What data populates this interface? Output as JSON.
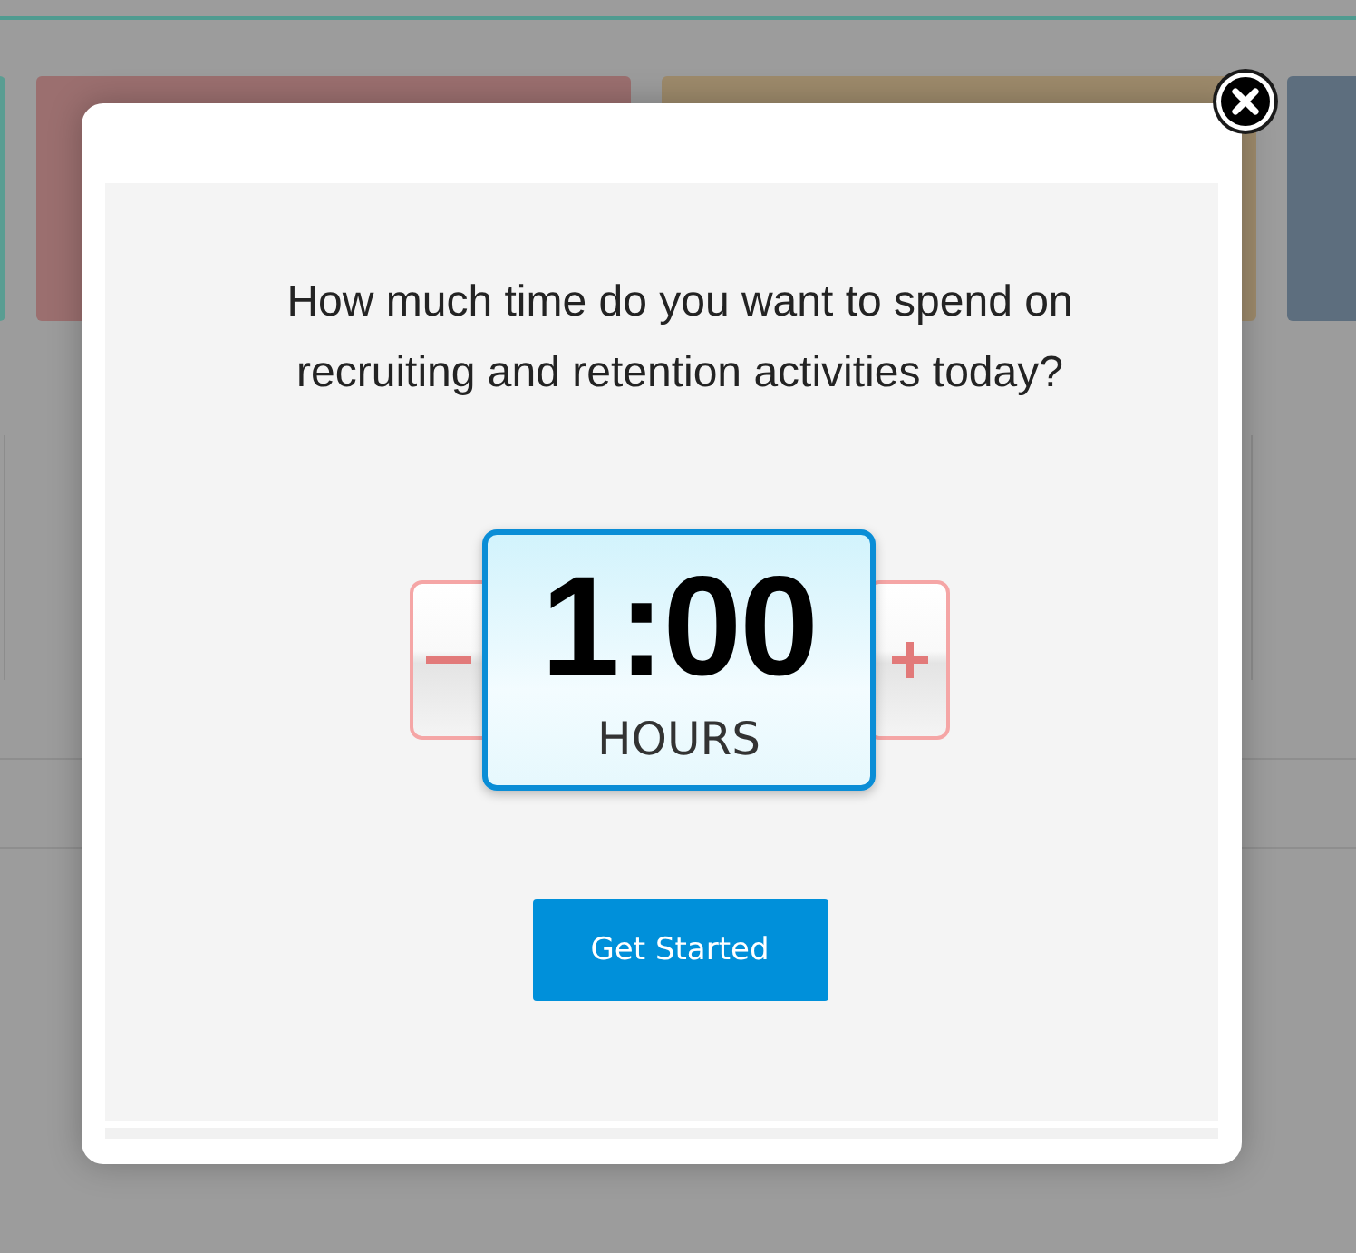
{
  "backdrop": {
    "tiles": [
      {
        "color": "#5a9d92"
      },
      {
        "color": "#9b6f6f"
      },
      {
        "color": "#9d8a6b"
      },
      {
        "color": "#5d6e7e"
      }
    ]
  },
  "dialog": {
    "question": "How much time do you want to spend on recruiting and retention activities today?",
    "stepper": {
      "value": "1:00",
      "unit": "HOURS"
    },
    "primary_button": "Get Started"
  }
}
